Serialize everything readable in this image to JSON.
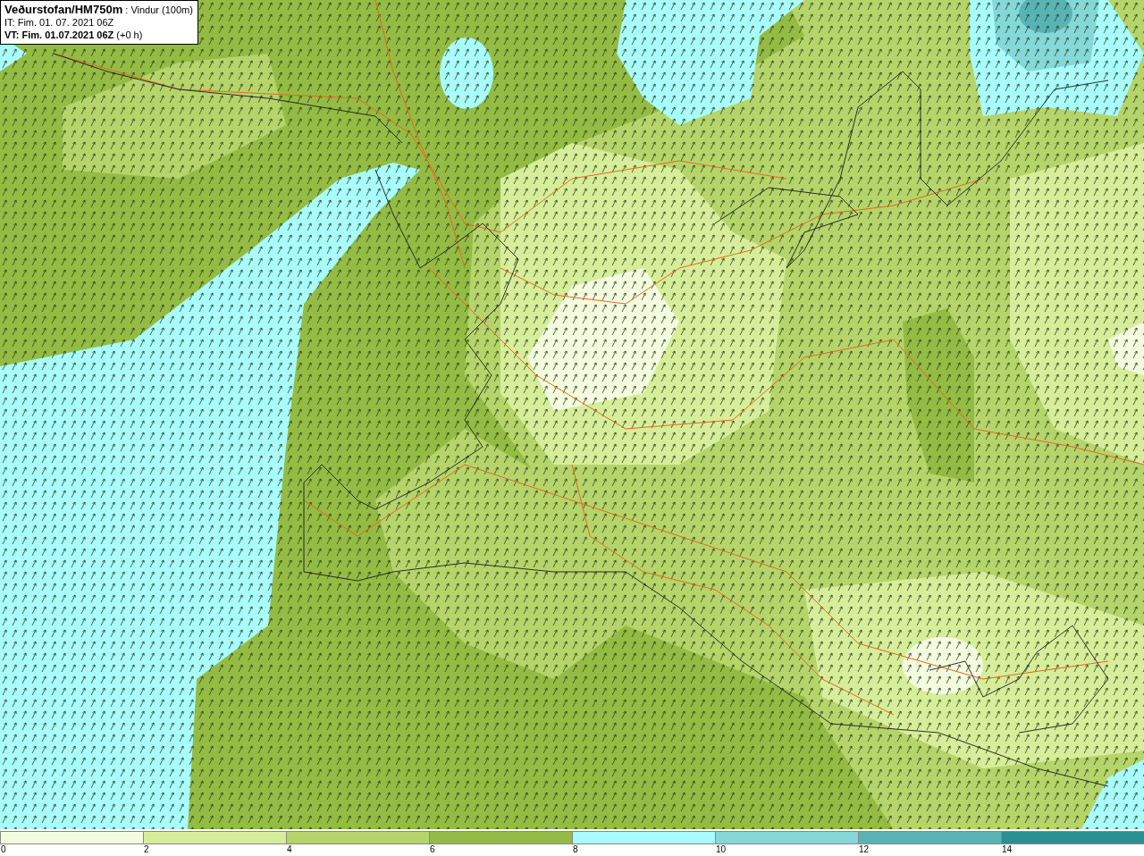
{
  "header": {
    "source": "Veðurstofan/HM750m",
    "variable": ": Vindur (100m)",
    "issue_time": "IT: Fim. 01. 07. 2021 06Z",
    "valid_time": "VT: Fim. 01.07.2021 06Z",
    "offset": "(+0 h)"
  },
  "legend": [
    {
      "label": "0",
      "color": "#f4fce0"
    },
    {
      "label": "2",
      "color": "#d6ee9a"
    },
    {
      "label": "4",
      "color": "#b5d56b"
    },
    {
      "label": "6",
      "color": "#94bc44"
    },
    {
      "label": "8",
      "color": "#a8fcfc"
    },
    {
      "label": "10",
      "color": "#84d8d8"
    },
    {
      "label": "12",
      "color": "#58b4b4"
    },
    {
      "label": "14",
      "color": "#2a9090"
    }
  ]
}
